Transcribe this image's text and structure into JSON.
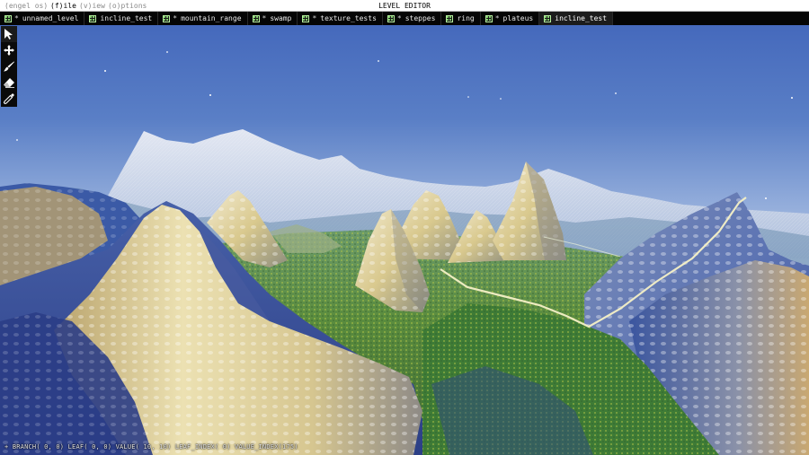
{
  "menubar": {
    "items": [
      {
        "label": "(engel os)",
        "enabled": false
      },
      {
        "label": "(f)ile",
        "enabled": true
      },
      {
        "label": "(v)iew",
        "enabled": false
      },
      {
        "label": "(o)ptions",
        "enabled": false
      }
    ],
    "title": "LEVEL EDITOR"
  },
  "tabs": [
    {
      "label": "unnamed_level",
      "modified": true,
      "active": false
    },
    {
      "label": "incline_test",
      "modified": false,
      "active": false
    },
    {
      "label": "mountain_range",
      "modified": true,
      "active": false
    },
    {
      "label": "swamp",
      "modified": true,
      "active": false
    },
    {
      "label": "texture_tests",
      "modified": true,
      "active": false
    },
    {
      "label": "steppes",
      "modified": true,
      "active": false
    },
    {
      "label": "ring",
      "modified": false,
      "active": false
    },
    {
      "label": "plateus",
      "modified": true,
      "active": false
    },
    {
      "label": "incline_test",
      "modified": false,
      "active": true
    }
  ],
  "modified_marker": "*",
  "tools": [
    {
      "icon": "select-arrow-icon",
      "active": true
    },
    {
      "icon": "move-cross-icon",
      "active": false
    },
    {
      "icon": "brush-icon",
      "active": false
    },
    {
      "icon": "eraser-icon",
      "active": false
    },
    {
      "icon": "eyedropper-icon",
      "active": false
    }
  ],
  "status": "+ BRANCH( 0, 0) LEAF( 0, 0) VALUE( 10, 10) LEAF_INDEX( 0) VALUE_INDEX(175)",
  "colors": {
    "sky_top": "#4a6fbe",
    "sky_horizon": "#a9c0dd",
    "mountain_light": "#e8dca6",
    "mountain_shadow": "#3f5aa6",
    "grass": "#4f8a3a",
    "path": "#f2efc0"
  }
}
